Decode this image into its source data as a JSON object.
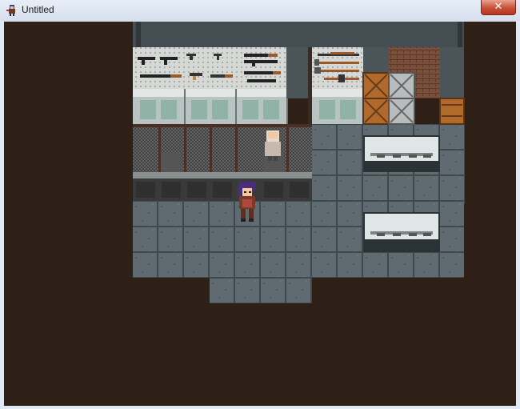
{
  "window": {
    "title": "Untitled",
    "close_glyph": "✕"
  },
  "icons": {
    "app": "rpg-character-icon",
    "close": "close-icon"
  },
  "colors": {
    "void": "#2e1f17",
    "floor": "#5d6a6e",
    "wall": "#3f4a4f",
    "counter": "#3a3a3a",
    "crate": "#b06a2c"
  }
}
